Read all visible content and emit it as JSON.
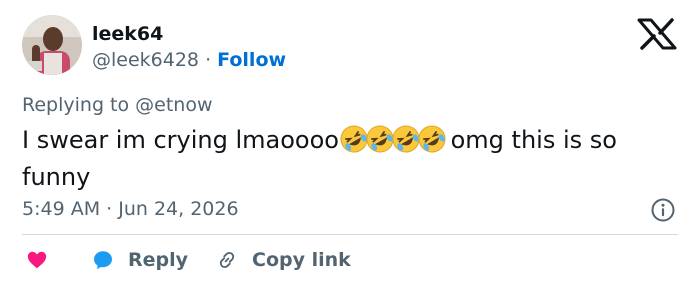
{
  "author": {
    "name": "leek64",
    "handle": "@leek6428",
    "separator": "·",
    "follow_label": "Follow"
  },
  "reply_context": {
    "prefix": "Replying to",
    "mention": "@etnow"
  },
  "tweet": {
    "text_before_emoji": "I swear im crying lmaoooo",
    "emoji": "🤣🤣🤣🤣",
    "text_after_emoji": " omg this is so funny"
  },
  "timestamp": "5:49 AM · Jun 24, 2026",
  "actions": {
    "reply_label": "Reply",
    "copy_link_label": "Copy link"
  },
  "icons": {
    "x_logo": "x-logo-icon",
    "info": "info-icon",
    "like": "heart-icon",
    "reply": "speech-bubble-icon",
    "copy": "link-icon"
  },
  "colors": {
    "text": "#0f1419",
    "muted": "#536471",
    "link": "#006fd6",
    "heart": "#f91880",
    "reply_bubble": "#1d9bf0",
    "divider": "#cfd9de"
  }
}
